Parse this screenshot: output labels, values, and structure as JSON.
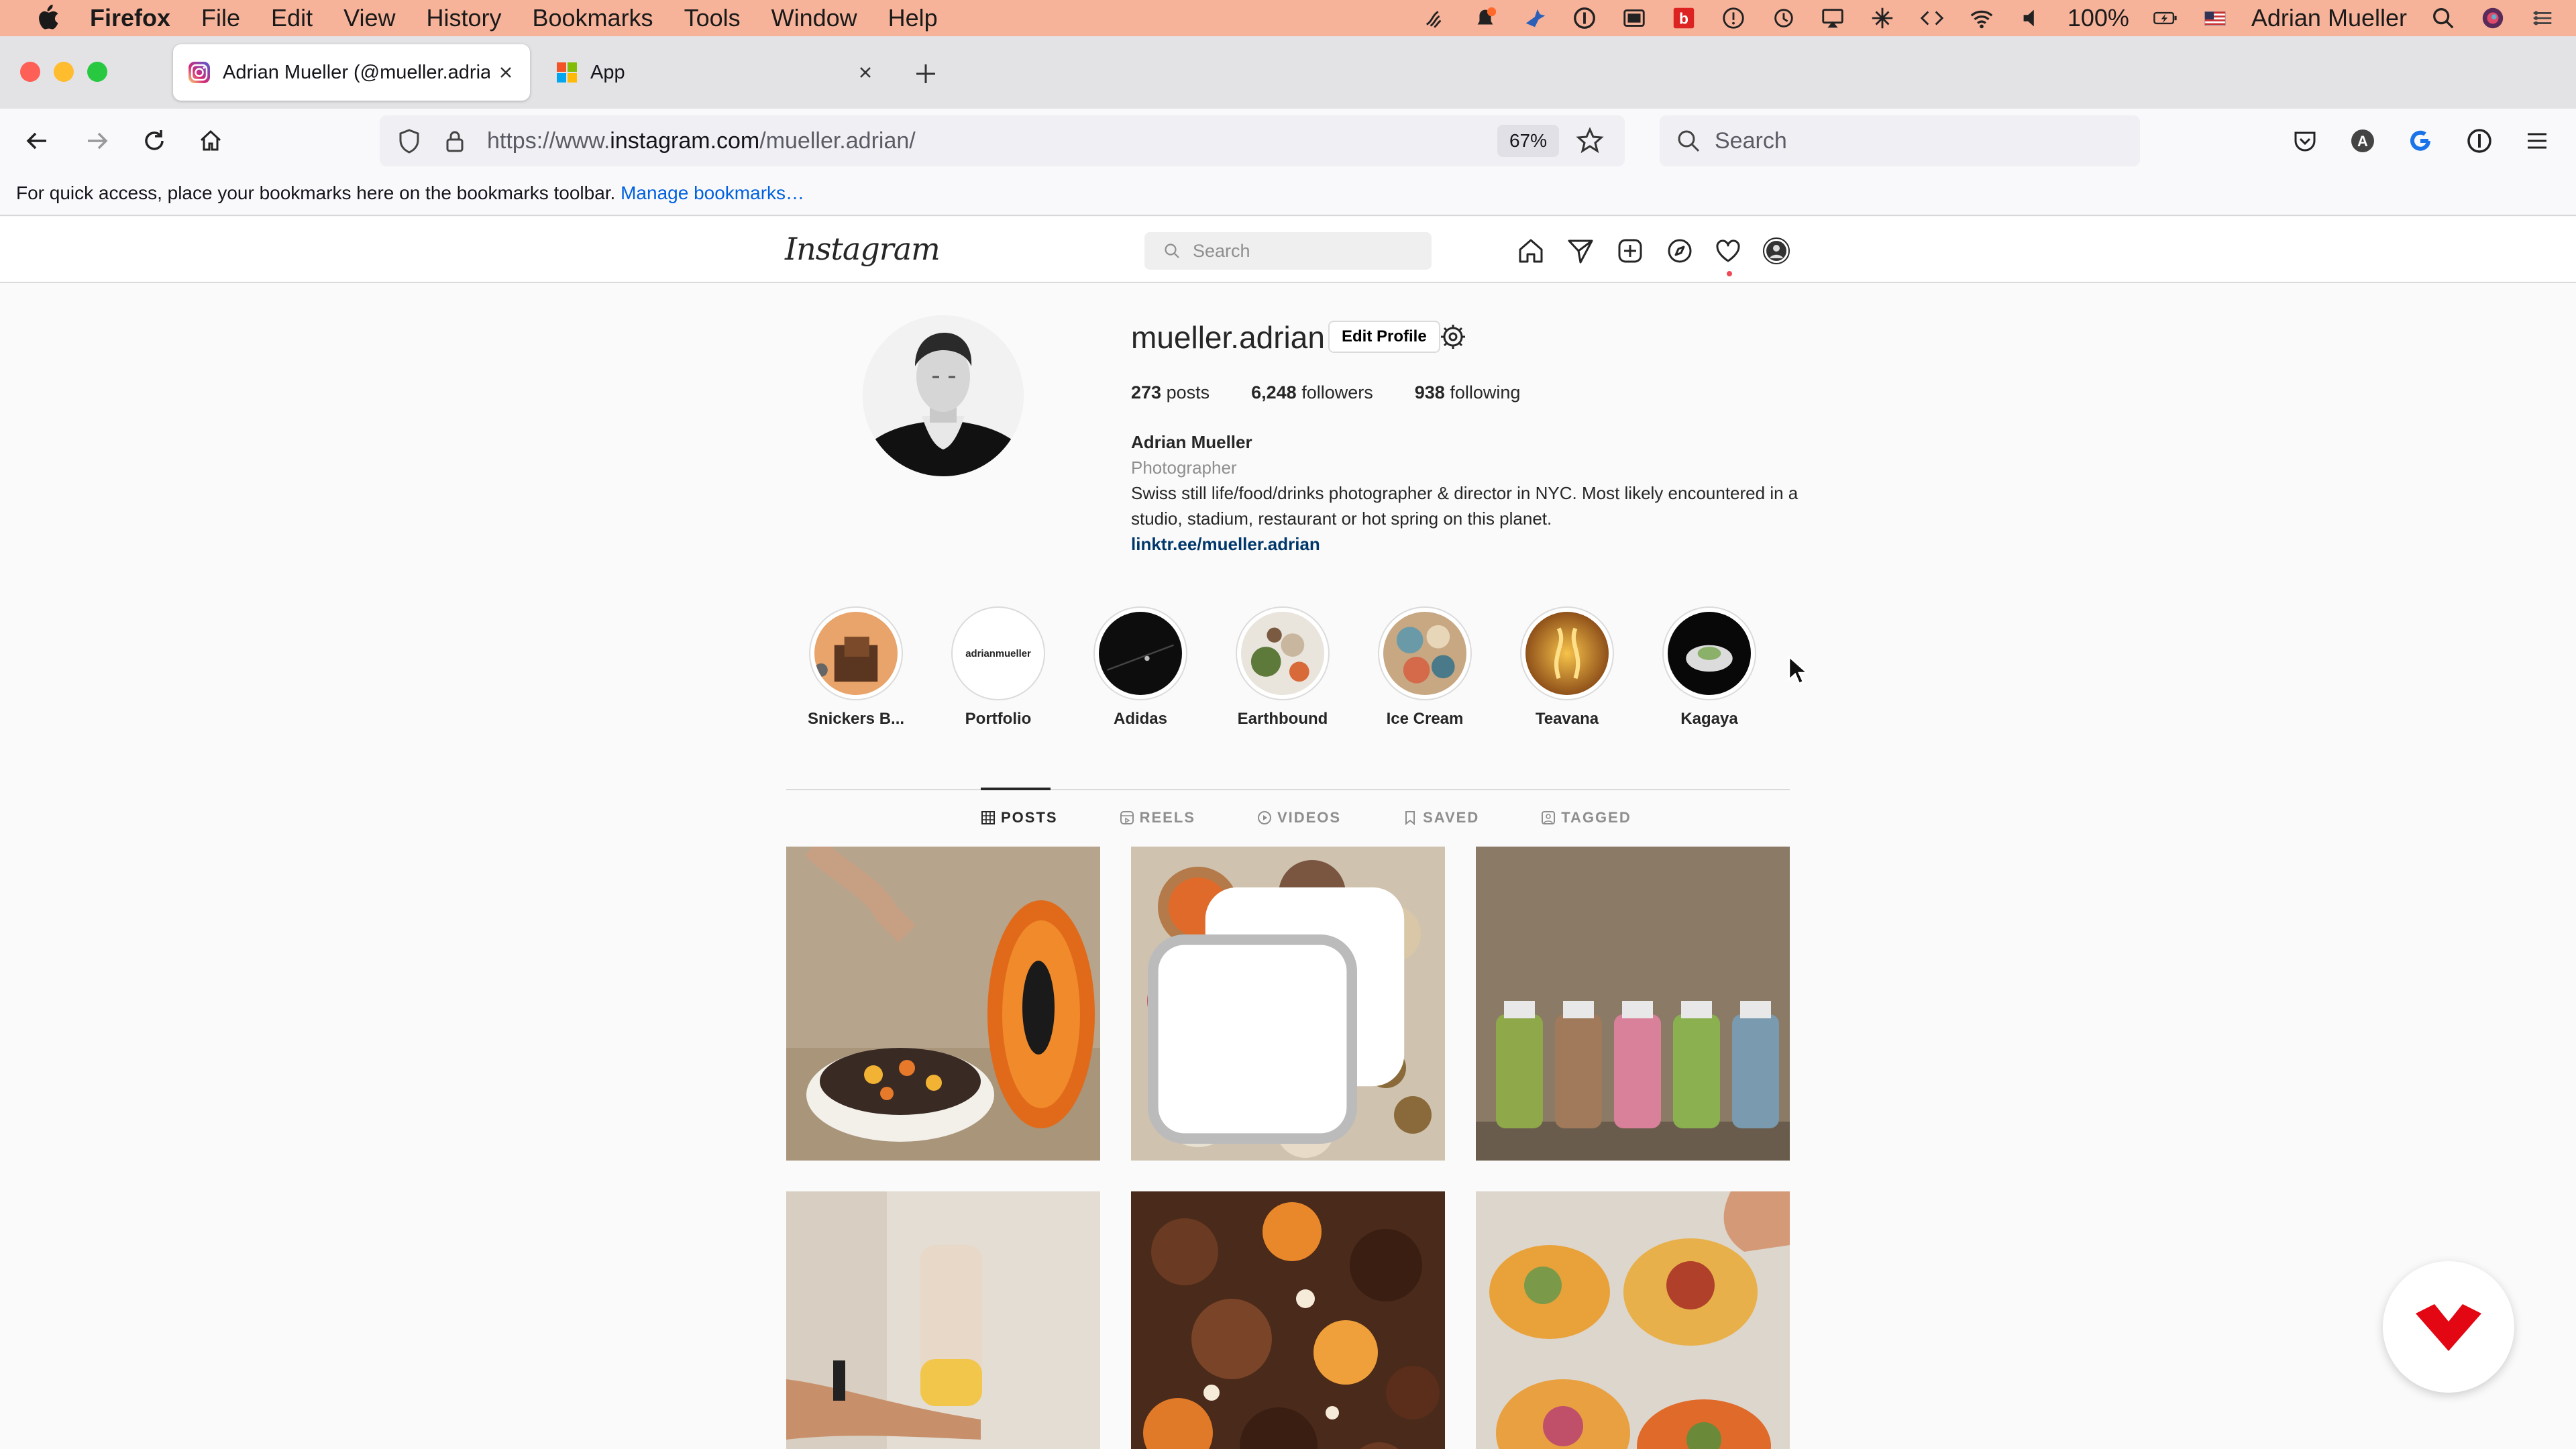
{
  "menubar": {
    "app_name": "Firefox",
    "items": [
      "File",
      "Edit",
      "View",
      "History",
      "Bookmarks",
      "Tools",
      "Window",
      "Help"
    ],
    "battery": "100%",
    "user": "Adrian Mueller"
  },
  "browser": {
    "tabs": [
      {
        "title": "Adrian Mueller (@mueller.adrian",
        "favicon": "instagram-icon"
      },
      {
        "title": "App",
        "favicon": "grid-icon"
      }
    ],
    "url_prefix": "https://www.",
    "url_domain": "instagram.com",
    "url_path": "/mueller.adrian/",
    "zoom": "67%",
    "search_placeholder": "Search",
    "bookmarks_message": "For quick access, place your bookmarks here on the bookmarks toolbar.",
    "bookmarks_link": "Manage bookmarks…"
  },
  "instagram": {
    "logo": "Instagram",
    "search_placeholder": "Search",
    "profile": {
      "username": "mueller.adrian",
      "edit_button": "Edit Profile",
      "posts_count": "273",
      "posts_label": "posts",
      "followers_count": "6,248",
      "followers_label": "followers",
      "following_count": "938",
      "following_label": "following",
      "full_name": "Adrian Mueller",
      "category": "Photographer",
      "bio": "Swiss still life/food/drinks photographer & director in NYC. Most likely encountered in a studio, stadium, restaurant or hot spring on this planet.",
      "link": "linktr.ee/mueller.adrian"
    },
    "highlights": [
      {
        "label": "Snickers B...",
        "thumb_text": ""
      },
      {
        "label": "Portfolio",
        "thumb_text": "adrianmueller"
      },
      {
        "label": "Adidas",
        "thumb_text": ""
      },
      {
        "label": "Earthbound",
        "thumb_text": ""
      },
      {
        "label": "Ice Cream",
        "thumb_text": ""
      },
      {
        "label": "Teavana",
        "thumb_text": ""
      },
      {
        "label": "Kagaya",
        "thumb_text": ""
      }
    ],
    "tabs": [
      "POSTS",
      "REELS",
      "VIDEOS",
      "SAVED",
      "TAGGED"
    ],
    "active_tab": "POSTS"
  },
  "colors": {
    "menubar_bg": "#f6b39a",
    "link_blue": "#00376b",
    "firefox_link": "#0061e0",
    "floating_brand": "#e30613"
  }
}
